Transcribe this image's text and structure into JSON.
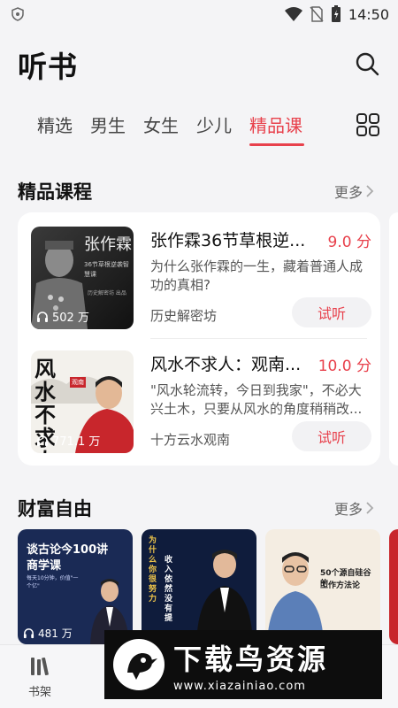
{
  "status_bar": {
    "time": "14:50"
  },
  "header": {
    "title": "听书"
  },
  "tabs": [
    {
      "label": "精选"
    },
    {
      "label": "男生"
    },
    {
      "label": "女生"
    },
    {
      "label": "少儿"
    },
    {
      "label": "精品课",
      "active": true
    }
  ],
  "premium_section": {
    "title": "精品课程",
    "more_label": "更多",
    "courses": [
      {
        "name": "张作霖36节草根逆...",
        "score": "9.0 分",
        "description": "为什么张作霖的一生，藏着普通人成功的真相?",
        "author": "历史解密坊",
        "try_label": "试听",
        "listen_count": "502 万",
        "cover": {
          "big_text": "张作霖",
          "sub_text": "36节草根逆袭智慧课",
          "publisher": "历史解密坊 出品"
        }
      },
      {
        "name": "风水不求人：观南...",
        "score": "10.0 分",
        "description": "\"风水轮流转，今日到我家\"，不必大兴土木，只要从风水的角度稍稍改...",
        "author": "十方云水观南",
        "try_label": "试听",
        "listen_count": "771.1 万",
        "cover": {
          "big_text": "风水不求人",
          "tag": "观南"
        }
      }
    ]
  },
  "wealth_section": {
    "title": "财富自由",
    "more_label": "更多",
    "items": [
      {
        "cover_title": "谈古论今100讲",
        "cover_title2": "商学课",
        "cover_sub": "每天10分钟，价值\"一个亿\"",
        "listen_count": "481 万"
      },
      {
        "cover_title": "为什么你很努力",
        "cover_title2": "收入依然没有提"
      },
      {
        "cover_title": "50个源自硅谷的",
        "cover_title2": "工作方法论"
      }
    ]
  },
  "bottom_nav": {
    "bookshelf_label": "书架"
  },
  "watermark": {
    "brand": "下载鸟资源",
    "url": "www.xiazainiao.com"
  },
  "colors": {
    "accent": "#e8414c",
    "background": "#f4f4f6"
  }
}
